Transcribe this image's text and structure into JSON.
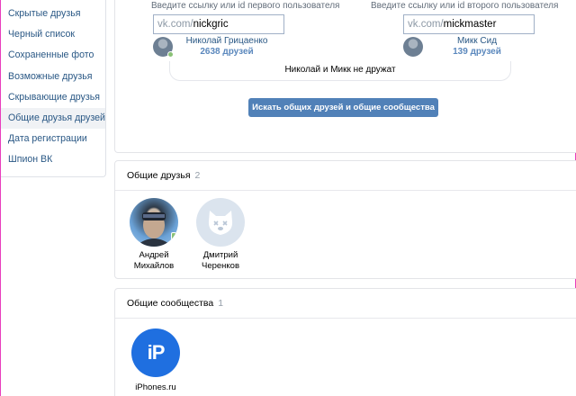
{
  "sidebar": {
    "items": [
      {
        "label": "Скрытые друзья"
      },
      {
        "label": "Черный список"
      },
      {
        "label": "Сохраненные фото"
      },
      {
        "label": "Возможные друзья"
      },
      {
        "label": "Скрывающие друзья"
      },
      {
        "label": "Общие друзья друзей",
        "active": true
      },
      {
        "label": "Дата регистрации"
      },
      {
        "label": "Шпион ВК"
      }
    ]
  },
  "compare": {
    "first": {
      "hint": "Введите ссылку или id первого пользователя",
      "prefix": "vk.com/",
      "value": "nickgric",
      "name": "Николай Грицаенко",
      "count": "2638 друзей",
      "online": true
    },
    "second": {
      "hint": "Введите ссылку или id второго пользователя",
      "prefix": "vk.com/",
      "value": "mickmaster",
      "name": "Микк Сид",
      "count": "139 друзей",
      "online": false
    },
    "status": "Николай и Микк не дружат",
    "button_label": "Искать общих друзей и общие сообщества"
  },
  "friends": {
    "title": "Общие друзья",
    "count": "2",
    "items": [
      {
        "first_name": "Андрей",
        "last_name": "Михайлов",
        "avatar": "photo",
        "online": true
      },
      {
        "first_name": "Дмитрий",
        "last_name": "Черенков",
        "avatar": "deactivated-dog",
        "online": false
      }
    ]
  },
  "groups": {
    "title": "Общие сообщества",
    "count": "1",
    "items": [
      {
        "name": "iPhones.ru",
        "logo_text": "iP",
        "logo_color": "#1f6fe0"
      }
    ]
  },
  "colors": {
    "link": "#2a5885",
    "button": "#5181b8",
    "online": "#8ac176",
    "frame": "#e83ebd"
  }
}
